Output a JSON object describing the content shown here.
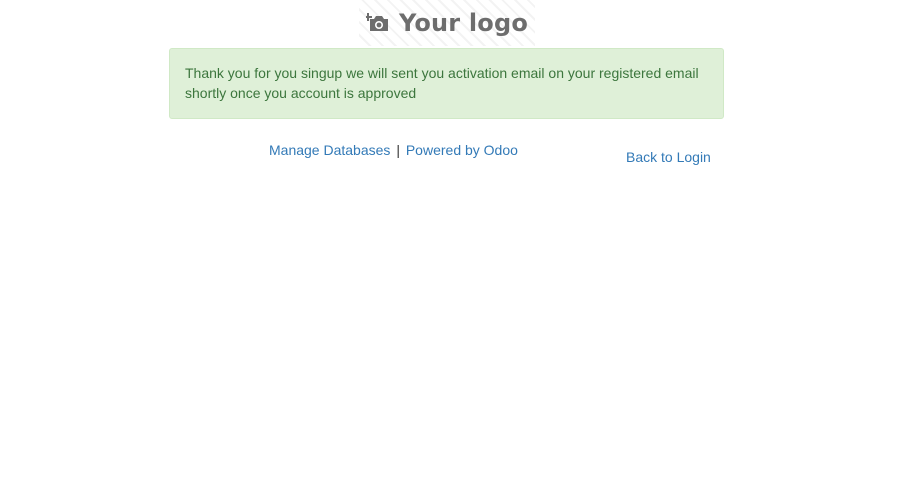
{
  "logo": {
    "text": "Your logo",
    "icon": "camera-add-icon",
    "color": "#6d6d6d"
  },
  "alert": {
    "message": "Thank you for you singup we will sent you activation email on your registered email shortly once you account is approved",
    "background": "#dff0d8",
    "text_color": "#3c763d"
  },
  "footer": {
    "manage_databases": "Manage Databases",
    "separator": "|",
    "powered_by": "Powered by Odoo"
  },
  "back_to_login": "Back to Login",
  "colors": {
    "link": "#337ab7"
  }
}
